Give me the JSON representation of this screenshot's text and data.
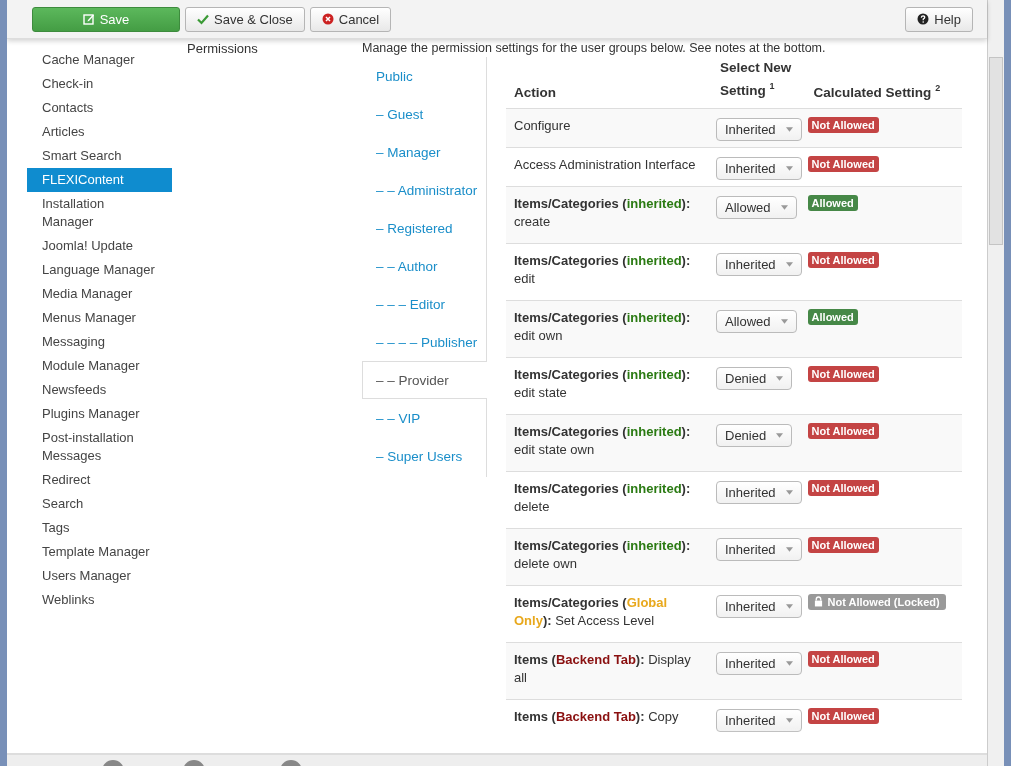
{
  "toolbar": {
    "buttons": [
      {
        "kind": "save",
        "label": "Save"
      },
      {
        "kind": "save-close",
        "label": "Save & Close"
      },
      {
        "kind": "cancel",
        "label": "Cancel"
      }
    ],
    "help": {
      "label": "Help"
    }
  },
  "sidebar": {
    "items": [
      {
        "label": "Cache Manager",
        "selected": false
      },
      {
        "label": "Check-in",
        "selected": false
      },
      {
        "label": "Contacts",
        "selected": false
      },
      {
        "label": "Articles",
        "selected": false
      },
      {
        "label": "Smart Search",
        "selected": false
      },
      {
        "label": "FLEXIContent",
        "selected": true
      },
      {
        "label": "Installation Manager",
        "selected": false
      },
      {
        "label": "Joomla! Update",
        "selected": false
      },
      {
        "label": "Language Manager",
        "selected": false
      },
      {
        "label": "Media Manager",
        "selected": false
      },
      {
        "label": "Menus Manager",
        "selected": false
      },
      {
        "label": "Messaging",
        "selected": false
      },
      {
        "label": "Module Manager",
        "selected": false
      },
      {
        "label": "Newsfeeds",
        "selected": false
      },
      {
        "label": "Plugins Manager",
        "selected": false
      },
      {
        "label": "Post-installation Messages",
        "selected": false
      },
      {
        "label": "Redirect",
        "selected": false
      },
      {
        "label": "Search",
        "selected": false
      },
      {
        "label": "Tags",
        "selected": false
      },
      {
        "label": "Template Manager",
        "selected": false
      },
      {
        "label": "Users Manager",
        "selected": false
      },
      {
        "label": "Weblinks",
        "selected": false
      }
    ]
  },
  "field_label": "Permissions",
  "intro": "Manage the permission settings for the user groups below. See notes at the bottom.",
  "groups": [
    {
      "label": "Public",
      "selected": false
    },
    {
      "label": "– Guest",
      "selected": false
    },
    {
      "label": "– Manager",
      "selected": false
    },
    {
      "label": "– – Administrator",
      "selected": false
    },
    {
      "label": "– Registered",
      "selected": false
    },
    {
      "label": "– – Author",
      "selected": false
    },
    {
      "label": "– – – Editor",
      "selected": false
    },
    {
      "label": "– – – – Publisher",
      "selected": false
    },
    {
      "label": "– – Provider",
      "selected": true
    },
    {
      "label": "– – VIP",
      "selected": false
    },
    {
      "label": "– Super Users",
      "selected": false
    }
  ],
  "table": {
    "columns": {
      "action": "Action",
      "select": "Select New Setting",
      "select_note": "1",
      "calculated": "Calculated Setting",
      "calculated_note": "2"
    },
    "rows": [
      {
        "kind": "plain",
        "action": "Configure",
        "setting": "Inherited",
        "result": {
          "text": "Not Allowed",
          "color": "#c44444"
        },
        "locked": false
      },
      {
        "kind": "plain",
        "action": "Access Administration Interface",
        "setting": "Inherited",
        "result": {
          "text": "Not Allowed",
          "color": "#c44444"
        },
        "locked": false
      },
      {
        "kind": "tagged",
        "prefix": "Items/Categories (",
        "tag": {
          "text": "inherited",
          "color": "#2a7a12"
        },
        "suffix": "):",
        "rest": "create",
        "setting": "Allowed",
        "result": {
          "text": "Allowed",
          "color": "#468847"
        },
        "locked": false
      },
      {
        "kind": "tagged",
        "prefix": "Items/Categories (",
        "tag": {
          "text": "inherited",
          "color": "#2a7a12"
        },
        "suffix": "):",
        "rest": "edit",
        "setting": "Inherited",
        "result": {
          "text": "Not Allowed",
          "color": "#c44444"
        },
        "locked": false
      },
      {
        "kind": "tagged",
        "prefix": "Items/Categories (",
        "tag": {
          "text": "inherited",
          "color": "#2a7a12"
        },
        "suffix": "):",
        "rest": "edit own",
        "setting": "Allowed",
        "result": {
          "text": "Allowed",
          "color": "#468847"
        },
        "locked": false
      },
      {
        "kind": "tagged",
        "prefix": "Items/Categories (",
        "tag": {
          "text": "inherited",
          "color": "#2a7a12"
        },
        "suffix": "):",
        "rest": "edit state",
        "setting": "Denied",
        "result": {
          "text": "Not Allowed",
          "color": "#c44444"
        },
        "locked": false
      },
      {
        "kind": "tagged",
        "prefix": "Items/Categories (",
        "tag": {
          "text": "inherited",
          "color": "#2a7a12"
        },
        "suffix": "):",
        "rest": "edit state own",
        "setting": "Denied",
        "result": {
          "text": "Not Allowed",
          "color": "#c44444"
        },
        "locked": false
      },
      {
        "kind": "tagged",
        "prefix": "Items/Categories (",
        "tag": {
          "text": "inherited",
          "color": "#2a7a12"
        },
        "suffix": "):",
        "rest": "delete",
        "setting": "Inherited",
        "result": {
          "text": "Not Allowed",
          "color": "#c44444"
        },
        "locked": false
      },
      {
        "kind": "tagged",
        "prefix": "Items/Categories (",
        "tag": {
          "text": "inherited",
          "color": "#2a7a12"
        },
        "suffix": "):",
        "rest": "delete own",
        "setting": "Inherited",
        "result": {
          "text": "Not Allowed",
          "color": "#c44444"
        },
        "locked": false
      },
      {
        "kind": "tagged",
        "prefix": "Items/Categories (",
        "tag": {
          "text": "Global Only",
          "color": "#e8a81c"
        },
        "suffix": "):",
        "rest": "Set Access Level",
        "setting": "Inherited",
        "result": {
          "text": "Not Allowed (Locked)",
          "color": "#999999"
        },
        "locked": true
      },
      {
        "kind": "tagged",
        "prefix": "Items (",
        "tag": {
          "text": "Backend Tab",
          "color": "#8a1010"
        },
        "suffix": "):",
        "rest": "Display all",
        "setting": "Inherited",
        "result": {
          "text": "Not Allowed",
          "color": "#c44444"
        },
        "locked": false
      },
      {
        "kind": "tagged",
        "prefix": "Items (",
        "tag": {
          "text": "Backend Tab",
          "color": "#8a1010"
        },
        "suffix": "):",
        "rest": "Copy",
        "setting": "Inherited",
        "result": {
          "text": "Not Allowed",
          "color": "#c44444"
        },
        "locked": false
      }
    ]
  }
}
